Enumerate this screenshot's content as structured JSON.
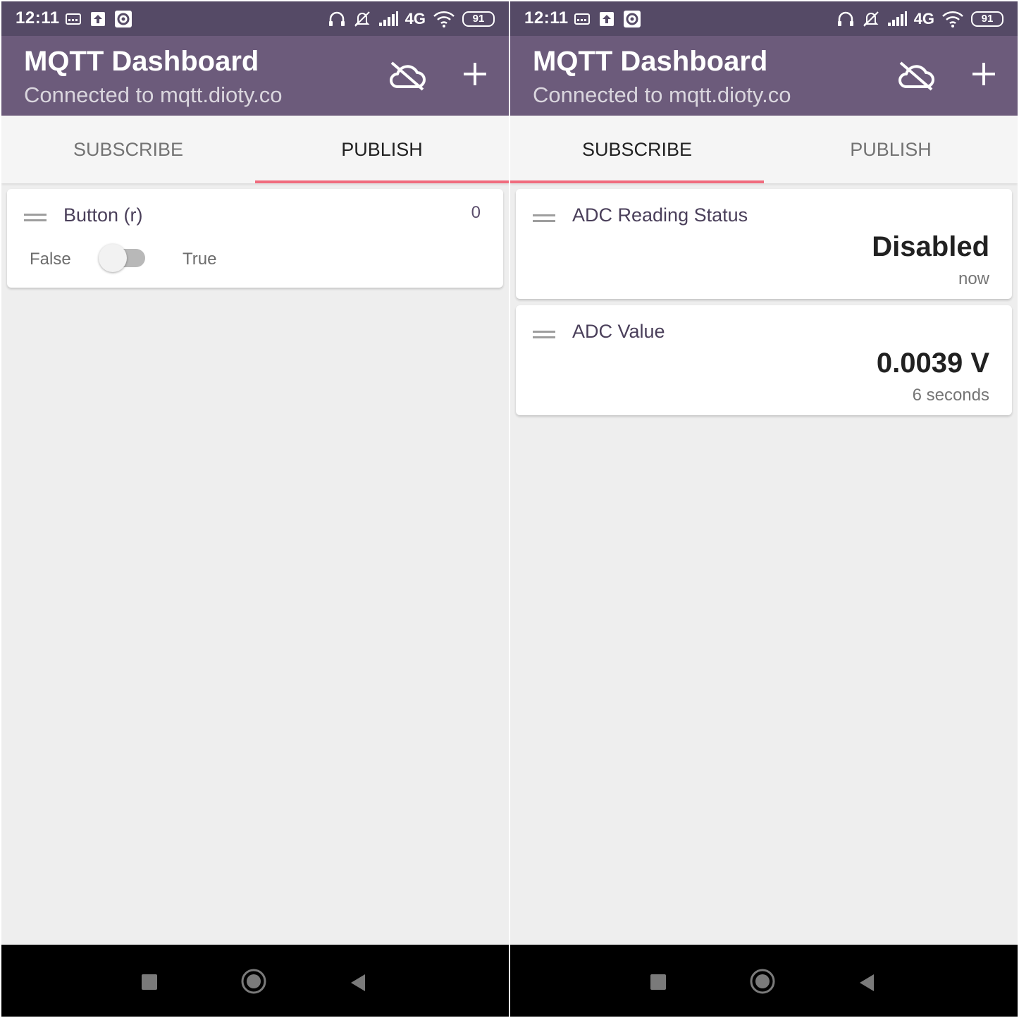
{
  "status_bar": {
    "time": "12:11",
    "network": "4G",
    "battery": "91",
    "icons_left": [
      "sim-card-icon",
      "upload-icon",
      "record-icon"
    ],
    "icons_right": [
      "headphones-icon",
      "mute-bell-icon",
      "signal-icon",
      "wifi-icon"
    ]
  },
  "app_bar": {
    "title": "MQTT Dashboard",
    "subtitle": "Connected to mqtt.dioty.co",
    "color": "#6c5b7b"
  },
  "tabs": [
    {
      "label": "SUBSCRIBE"
    },
    {
      "label": "PUBLISH"
    }
  ],
  "accent_color": "#f06b7d",
  "publish_screen": {
    "active_tab": "PUBLISH",
    "cards": [
      {
        "title": "Button (r)",
        "count": "0",
        "false_label": "False",
        "true_label": "True",
        "switch_on": false
      }
    ]
  },
  "subscribe_screen": {
    "active_tab": "SUBSCRIBE",
    "cards": [
      {
        "title": "ADC Reading Status",
        "value": "Disabled",
        "time": "now"
      },
      {
        "title": "ADC Value",
        "value": "0.0039 V",
        "time": "6 seconds"
      }
    ]
  },
  "nav_bar": {
    "icons": [
      "recents-square-icon",
      "home-circle-icon",
      "back-triangle-icon"
    ]
  }
}
